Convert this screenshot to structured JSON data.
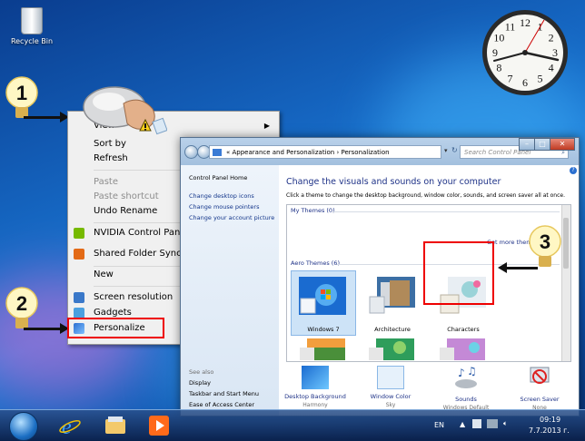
{
  "desktop": {
    "recycle_label": "Recycle Bin"
  },
  "callouts": [
    "1",
    "2",
    "3"
  ],
  "context_menu": {
    "items": [
      {
        "label": "View",
        "disabled": false,
        "has_arrow": true
      },
      {
        "label": "Sort by",
        "disabled": false
      },
      {
        "label": "Refresh",
        "disabled": false
      },
      {
        "label": "Paste",
        "disabled": true
      },
      {
        "label": "Paste shortcut",
        "disabled": true
      },
      {
        "label": "Undo Rename",
        "disabled": false
      },
      {
        "label": "NVIDIA Control Panel",
        "disabled": false
      },
      {
        "label": "Shared Folder Synchronization",
        "disabled": false
      },
      {
        "label": "New",
        "disabled": false
      },
      {
        "label": "Screen resolution",
        "disabled": false
      },
      {
        "label": "Gadgets",
        "disabled": false
      },
      {
        "label": "Personalize",
        "disabled": false
      }
    ]
  },
  "window": {
    "address": "« Appearance and Personalization › Personalization",
    "search_placeholder": "Search Control Panel",
    "left_pane": {
      "home": "Control Panel Home",
      "links": [
        "Change desktop icons",
        "Change mouse pointers",
        "Change your account picture"
      ],
      "see_also": "See also",
      "see_also_links": [
        "Display",
        "Taskbar and Start Menu",
        "Ease of Access Center"
      ]
    },
    "main": {
      "heading": "Change the visuals and sounds on your computer",
      "subheading": "Click a theme to change the desktop background, window color, sounds, and screen saver all at once.",
      "my_themes": "My Themes (0)",
      "get_more": "Get more themes online",
      "aero_themes": "Aero Themes (6)",
      "themes": [
        {
          "name": "Windows 7",
          "selected": true
        },
        {
          "name": "Architecture",
          "selected": false
        },
        {
          "name": "Characters",
          "selected": false
        }
      ]
    },
    "bottom": [
      {
        "label": "Desktop Background",
        "sub": "Harmony"
      },
      {
        "label": "Window Color",
        "sub": "Sky"
      },
      {
        "label": "Sounds",
        "sub": "Windows Default"
      },
      {
        "label": "Screen Saver",
        "sub": "None"
      }
    ]
  },
  "taskbar": {
    "language": "EN",
    "time": "09:19",
    "date": "7.7.2013 г."
  },
  "clock": {
    "numerals": [
      "12",
      "1",
      "2",
      "3",
      "4",
      "5",
      "6",
      "7",
      "8",
      "9",
      "10",
      "11"
    ]
  },
  "colors": {
    "highlight": "#e00000",
    "link": "#1e3287"
  }
}
